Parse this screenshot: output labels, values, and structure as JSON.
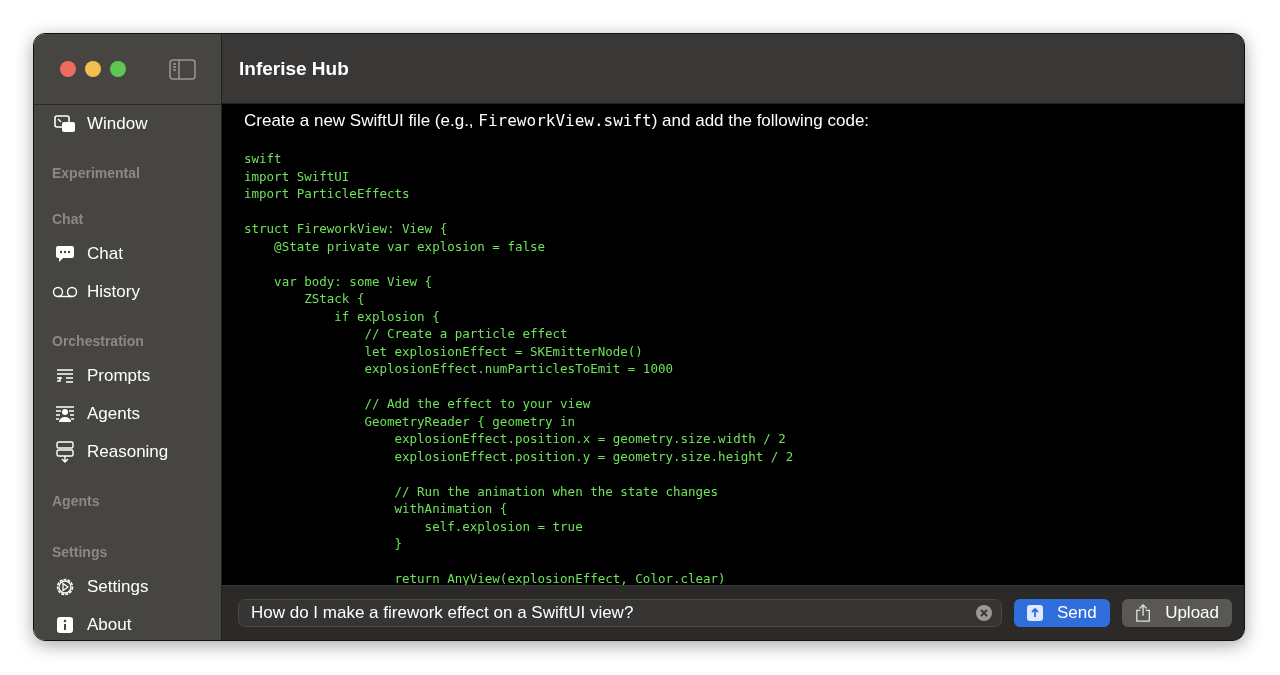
{
  "window": {
    "title": "Inferise Hub"
  },
  "sidebar": {
    "sections": [
      {
        "items": [
          {
            "label": "Window",
            "kind": "window"
          }
        ]
      },
      {
        "title": "Experimental"
      },
      {
        "title": "Chat",
        "items": [
          {
            "label": "Chat",
            "kind": "chat"
          },
          {
            "label": "History",
            "kind": "history"
          }
        ]
      },
      {
        "title": "Orchestration",
        "items": [
          {
            "label": "Prompts",
            "kind": "prompts"
          },
          {
            "label": "Agents",
            "kind": "agents"
          },
          {
            "label": "Reasoning",
            "kind": "reasoning"
          }
        ]
      },
      {
        "title": "Agents"
      },
      {
        "title": "Settings",
        "items": [
          {
            "label": "Settings",
            "kind": "settings"
          },
          {
            "label": "About",
            "kind": "about"
          }
        ]
      }
    ]
  },
  "message": {
    "intro": [
      {
        "kind": "text",
        "text": "Create a new SwiftUI file (e.g., "
      },
      {
        "kind": "code",
        "text": "FireworkView.swift"
      },
      {
        "kind": "text",
        "text": ") and add the following code:"
      }
    ],
    "code": "swift\nimport SwiftUI\nimport ParticleEffects\n\nstruct FireworkView: View {\n    @State private var explosion = false\n\n    var body: some View {\n        ZStack {\n            if explosion {\n                // Create a particle effect\n                let explosionEffect = SKEmitterNode()\n                explosionEffect.numParticlesToEmit = 1000\n\n                // Add the effect to your view\n                GeometryReader { geometry in\n                    explosionEffect.position.x = geometry.size.width / 2\n                    explosionEffect.position.y = geometry.size.height / 2\n\n                    // Run the animation when the state changes\n                    withAnimation {\n                        self.explosion = true\n                    }\n\n                    return AnyView(explosionEffect, Color.clear)"
  },
  "composer": {
    "value": "How do I make a firework effect on a SwiftUI view?",
    "buttons": [
      {
        "label": "Send",
        "kind": "primary"
      },
      {
        "label": "Upload",
        "kind": "secondary"
      }
    ]
  }
}
